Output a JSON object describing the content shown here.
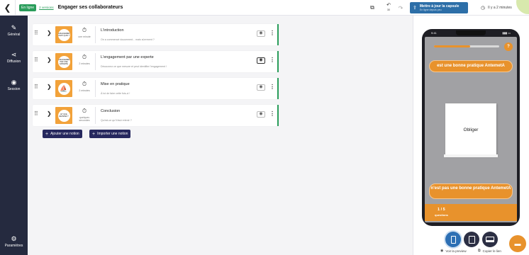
{
  "topbar": {
    "back_icon": "arrow-left-icon",
    "status_badge": "En ligne",
    "publications_link": "2 versions",
    "title": "Engager ses collaborateurs",
    "translate_icon": "translate-icon",
    "undo_label": "30",
    "update_title": "Mettre à jour la capsule",
    "update_subtitle": "En ligne depuis peu",
    "time_ago": "Il y a 2 minutes"
  },
  "sidebar": {
    "items": [
      {
        "label": "Général",
        "icon": "pencil-icon"
      },
      {
        "label": "Diffusion",
        "icon": "share-icon"
      },
      {
        "label": "Session",
        "icon": "radio-icon"
      },
      {
        "label": "Paramètres",
        "icon": "gear-icon"
      }
    ]
  },
  "notions": [
    {
      "title": "L'introduction",
      "subtitle": "On a commencé doucement... mais sûrement ?",
      "duration": "une minute",
      "thumb_text": "L'ENGAGEMENT C'EST QUOI ?",
      "preview_active": false
    },
    {
      "title": "L'engagement par une experte",
      "subtitle": "Découvrez ce que mesure et peut identifier l'engagement !",
      "duration": "2 minutes",
      "thumb_text": "L'ENGAGEMENT PAR UNE EXPERTE",
      "preview_active": true
    },
    {
      "title": "Mise en pratique",
      "subtitle": "À toi de faire cette fois-ci !",
      "duration": "2 minutes",
      "thumb_text": "",
      "preview_active": false
    },
    {
      "title": "Conclusion",
      "subtitle": "Qu'est-ce qu'il faut retenir ?",
      "duration": "quelques secondes",
      "thumb_text": "ET QUE RETENIR ?",
      "preview_active": false
    }
  ],
  "actions": {
    "add_notion": "Ajouter une notion",
    "import_notion": "Importer une notion"
  },
  "preview": {
    "status_time": "9:41",
    "progress": 0.55,
    "answer_top": "est une bonne pratique AntemetA",
    "card_text": "Obliger",
    "answer_bottom": "n'est pas une bonne pratique AntemetA",
    "counter": "1 / 5",
    "counter_label": "questions",
    "devices": [
      "phone-icon",
      "tablet-icon",
      "desktop-icon"
    ],
    "view_preview": "Voir la preview",
    "copy_link": "Copier le lien"
  },
  "colors": {
    "sidebar": "#252a3f",
    "accent_green": "#2a9d5b",
    "orange": "#e8922c",
    "primary_blue": "#2c6fb4",
    "action_navy": "#26285e"
  }
}
